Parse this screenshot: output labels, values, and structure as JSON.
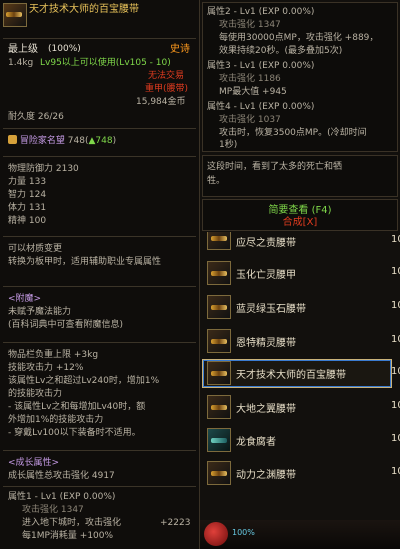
{
  "item": {
    "name": "天才技术大师的百宝腰带",
    "max_level": "最上级",
    "max_level_pct": "(100%)",
    "rarity": "史诗",
    "weight": "1.4kg",
    "level_req": "Lv95以上可以使用(Lv105 - 10)",
    "trade": "无法交易",
    "heavy": "重甲(腰带)",
    "price": "15,984金币",
    "durability": "耐久度 26/26",
    "fame": "冒险家名望",
    "fame_value": "748(",
    "fame_up": "▲748",
    "fame_close": ")",
    "stats": [
      "物理防御力 2130",
      "力量 133",
      "智力 124",
      "体力 131",
      "精神 100"
    ],
    "transfer": [
      "可以材质变更",
      "转换为板甲时，适用辅助职业专属属性"
    ],
    "enchant_title": "<附魔>",
    "enchant_lines": [
      "未赋予魔法能力",
      "(百科词典中可查看附魔信息)"
    ],
    "effects": [
      "物品栏负重上限 +3kg",
      "技能攻击力 +12%",
      "该属性Lv之和超过Lv240时，增加1%",
      "的技能攻击力",
      "- 该属性Lv之和每增加Lv40时，额",
      "外增加1%的技能攻击力",
      "- 穿戴Lv100以下装备时不适用。"
    ],
    "growth_title": "<成长属性>",
    "growth_total": "成长属性总攻击强化 4917",
    "growth1": "属性1 - Lv1 (EXP 0.00%)",
    "growth1_atk": "攻击强化 1347",
    "growth1_l1": "进入地下城时，攻击强化",
    "growth1_l1v": "+2223",
    "growth1_l2": "每1MP消耗量 +100%"
  },
  "right_box": {
    "attr2": "属性2 - Lv1 (EXP 0.00%)",
    "attr2_atk": "攻击强化 1347",
    "attr2_l1": "每使用30000点MP，攻击强化 +889，",
    "attr2_l2": "效果持续20秒。(最多叠加5次)",
    "attr3": "属性3 - Lv1 (EXP 0.00%)",
    "attr3_atk": "攻击强化 1186",
    "attr3_l1": "MP最大值 +945",
    "attr4": "属性4 - Lv1 (EXP 0.00%)",
    "attr4_atk": "攻击强化 1037",
    "attr4_l1": "攻击时，恢复3500点MP。(冷却时间",
    "attr4_l2": "1秒)",
    "flavor_l1": "这段时间，看到了太多的死亡和牺",
    "flavor_l2": "牲。",
    "simple_view": "简要查看 (F4)",
    "synthesis": "合成[X]"
  },
  "list": [
    {
      "label": "应尽之责腰带",
      "lv": "10"
    },
    {
      "label": "玉化亡灵腰甲",
      "lv": "10"
    },
    {
      "label": "蓝灵绿玉石腰带",
      "lv": "10"
    },
    {
      "label": "恩特精灵腰带",
      "lv": "10"
    },
    {
      "label": "天才技术大师的百宝腰带",
      "lv": "10"
    },
    {
      "label": "大地之翼腰带",
      "lv": "10"
    },
    {
      "label": "龙食腐者",
      "lv": "10"
    },
    {
      "label": "动力之渊腰带",
      "lv": "10"
    }
  ],
  "bottom": {
    "pct": "100%"
  },
  "colors": {
    "gold": "#e8c25a",
    "epic": "#ff9a1e",
    "red": "#e03b1f",
    "green": "#7fd74a",
    "violet": "#c69be6"
  }
}
